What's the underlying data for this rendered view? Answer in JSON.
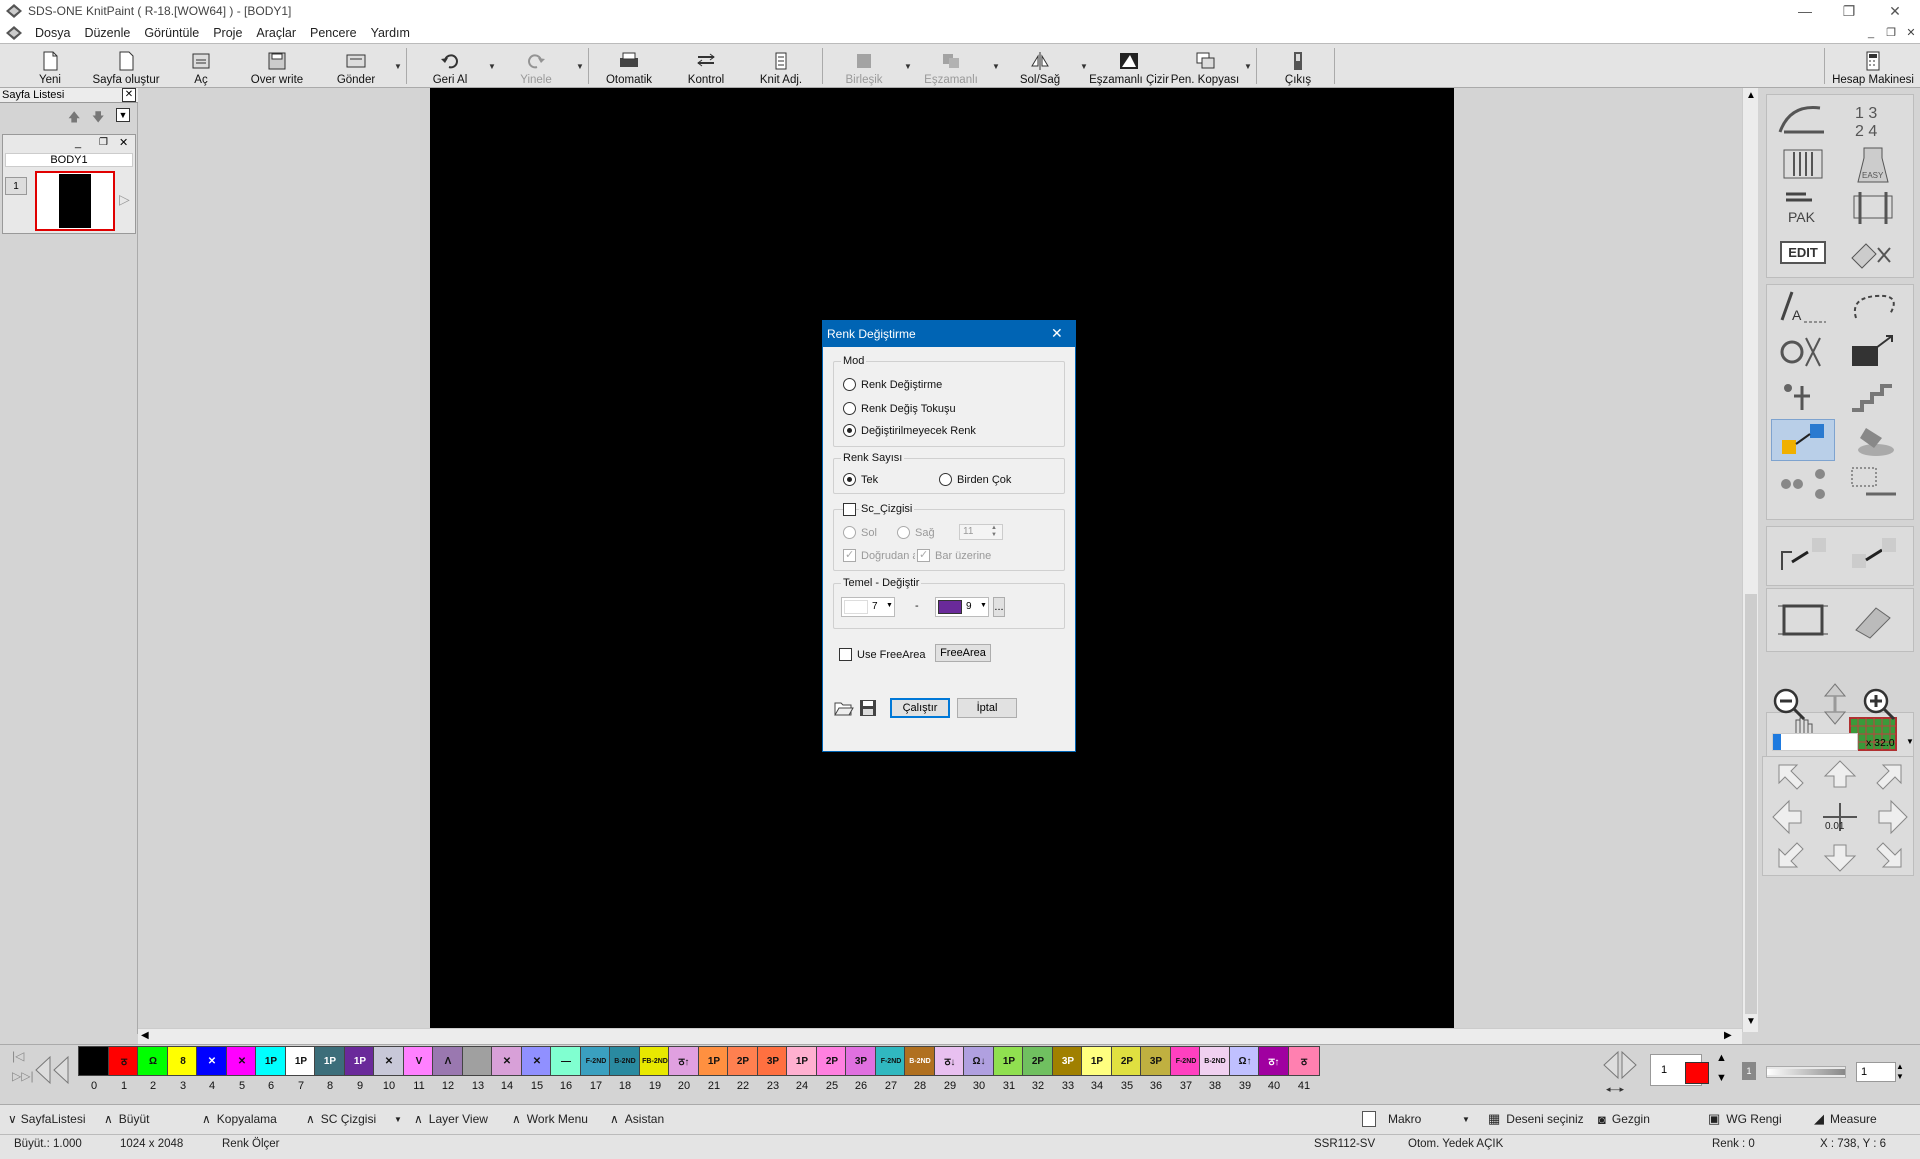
{
  "window": {
    "title": "SDS-ONE KnitPaint ( R-18.[WOW64] ) - [BODY1]"
  },
  "menu": [
    "Dosya",
    "Düzenle",
    "Görüntüle",
    "Proje",
    "Araçlar",
    "Pencere",
    "Yardım"
  ],
  "toolbar": {
    "yeni": "Yeni",
    "sayfa_olustur": "Sayfa oluştur",
    "ac": "Aç",
    "overwrite": "Over write",
    "gonder": "Gönder",
    "geri_al": "Geri Al",
    "yinele": "Yinele",
    "otomatik": "Otomatik",
    "kontrol": "Kontrol",
    "knit_adj": "Knit Adj.",
    "birlesik": "Birleşik",
    "eszamanli": "Eşzamanlı",
    "sol_sag": "Sol/Sağ",
    "eszamanli_cizir": "Eşzamanlı Çizir",
    "pen_kopyasi": "Pen. Kopyası",
    "cikis": "Çıkış",
    "hesap_makinesi": "Hesap Makinesi"
  },
  "sayfa_listesi": {
    "title": "Sayfa Listesi",
    "page_name": "BODY1",
    "page_number": "1"
  },
  "dialog": {
    "title": "Renk Değiştirme",
    "mod_label": "Mod",
    "mod_options": [
      "Renk Değiştirme",
      "Renk Değiş Tokuşu",
      "Değiştirilmeyecek Renk"
    ],
    "mod_selected": 2,
    "renk_sayisi_label": "Renk Sayısı",
    "tek": "Tek",
    "birden_cok": "Birden Çok",
    "sc_cizgisi": "Sc_Çizgisi",
    "sol": "Sol",
    "sag": "Sağ",
    "sc_value": "11",
    "dogrudan": "Doğrudan alan",
    "bar_uzerine": "Bar üzerine",
    "temel_label": "Temel - Değiştir",
    "from_value": "7",
    "from_color": "#ffffff",
    "dash": "-",
    "to_value": "9",
    "to_color": "#6a2a9a",
    "ellipsis": "...",
    "use_freearea": "Use FreeArea",
    "freearea_btn": "FreeArea",
    "calistir": "Çalıştır",
    "iptal": "İptal"
  },
  "zoom": {
    "label": "x 32.0",
    "step": "0.01"
  },
  "palette": [
    {
      "n": "0",
      "c": "#000000",
      "t": ""
    },
    {
      "n": "1",
      "c": "#ff0000",
      "t": "ठ"
    },
    {
      "n": "2",
      "c": "#00ff00",
      "t": "Ω"
    },
    {
      "n": "3",
      "c": "#ffff00",
      "t": "8"
    },
    {
      "n": "4",
      "c": "#0000ff",
      "t": "✕"
    },
    {
      "n": "5",
      "c": "#ff00ff",
      "t": "✕"
    },
    {
      "n": "6",
      "c": "#00ffff",
      "t": "1P"
    },
    {
      "n": "7",
      "c": "#ffffff",
      "t": "1P"
    },
    {
      "n": "8",
      "c": "#3c6e7a",
      "t": "1P"
    },
    {
      "n": "9",
      "c": "#6a2a9a",
      "t": "1P"
    },
    {
      "n": "10",
      "c": "#c8c8d8",
      "t": "✕"
    },
    {
      "n": "11",
      "c": "#ff80ff",
      "t": "V"
    },
    {
      "n": "12",
      "c": "#9a78b0",
      "t": "Λ"
    },
    {
      "n": "13",
      "c": "#a0a0a0",
      "t": ""
    },
    {
      "n": "14",
      "c": "#d8a0d8",
      "t": "✕"
    },
    {
      "n": "15",
      "c": "#9090ff",
      "t": "✕"
    },
    {
      "n": "16",
      "c": "#80ffd0",
      "t": "—"
    },
    {
      "n": "17",
      "c": "#3aa0c0",
      "t": "F-2ND"
    },
    {
      "n": "18",
      "c": "#2a8aa0",
      "t": "B-2ND"
    },
    {
      "n": "19",
      "c": "#e8e800",
      "t": "FB-2ND"
    },
    {
      "n": "20",
      "c": "#e0a0e0",
      "t": "ठ↑"
    },
    {
      "n": "21",
      "c": "#ff9040",
      "t": "1P"
    },
    {
      "n": "22",
      "c": "#ff8050",
      "t": "2P"
    },
    {
      "n": "23",
      "c": "#ff7040",
      "t": "3P"
    },
    {
      "n": "24",
      "c": "#ffb0d0",
      "t": "1P"
    },
    {
      "n": "25",
      "c": "#ff80e0",
      "t": "2P"
    },
    {
      "n": "26",
      "c": "#e070e0",
      "t": "3P"
    },
    {
      "n": "27",
      "c": "#30b8c0",
      "t": "F-2ND"
    },
    {
      "n": "28",
      "c": "#b07020",
      "t": "B-2ND"
    },
    {
      "n": "29",
      "c": "#e8c0f0",
      "t": "ठ↓"
    },
    {
      "n": "30",
      "c": "#b0a0e0",
      "t": "Ω↓"
    },
    {
      "n": "31",
      "c": "#90e050",
      "t": "1P"
    },
    {
      "n": "32",
      "c": "#70c060",
      "t": "2P"
    },
    {
      "n": "33",
      "c": "#a08000",
      "t": "3P"
    },
    {
      "n": "34",
      "c": "#ffff80",
      "t": "1P"
    },
    {
      "n": "35",
      "c": "#e0e040",
      "t": "2P"
    },
    {
      "n": "36",
      "c": "#c0b040",
      "t": "3P"
    },
    {
      "n": "37",
      "c": "#ff40c0",
      "t": "F-2ND"
    },
    {
      "n": "38",
      "c": "#f0d0f0",
      "t": "B-2ND"
    },
    {
      "n": "39",
      "c": "#c0c0ff",
      "t": "Ω↑"
    },
    {
      "n": "40",
      "c": "#a000a0",
      "t": "ठ↑"
    },
    {
      "n": "41",
      "c": "#ff80b0",
      "t": "ठ"
    }
  ],
  "palette_right": {
    "page": "1",
    "current_color": "#ff0000",
    "value": "1"
  },
  "bottom": {
    "sayfalistesi": "SayfaListesi",
    "buyut": "Büyüt",
    "kopyalama": "Kopyalama",
    "sc_cizgisi": "SC Çizgisi",
    "layer_view": "Layer View",
    "work_menu": "Work Menu",
    "asistan": "Asistan",
    "makro": "Makro",
    "deseni_seciniz": "Deseni seçiniz",
    "gezgin": "Gezgin",
    "wg_rengi": "WG Rengi",
    "measure": "Measure"
  },
  "status": {
    "buyut": "Büyüt.: 1.000",
    "size": "1024 x 2048",
    "renk_olcer": "Renk Ölçer",
    "machine": "SSR112-SV",
    "otom": "Otom. Yedek AÇIK",
    "renk": "Renk : 0",
    "coords": "X : 738, Y :  6"
  }
}
